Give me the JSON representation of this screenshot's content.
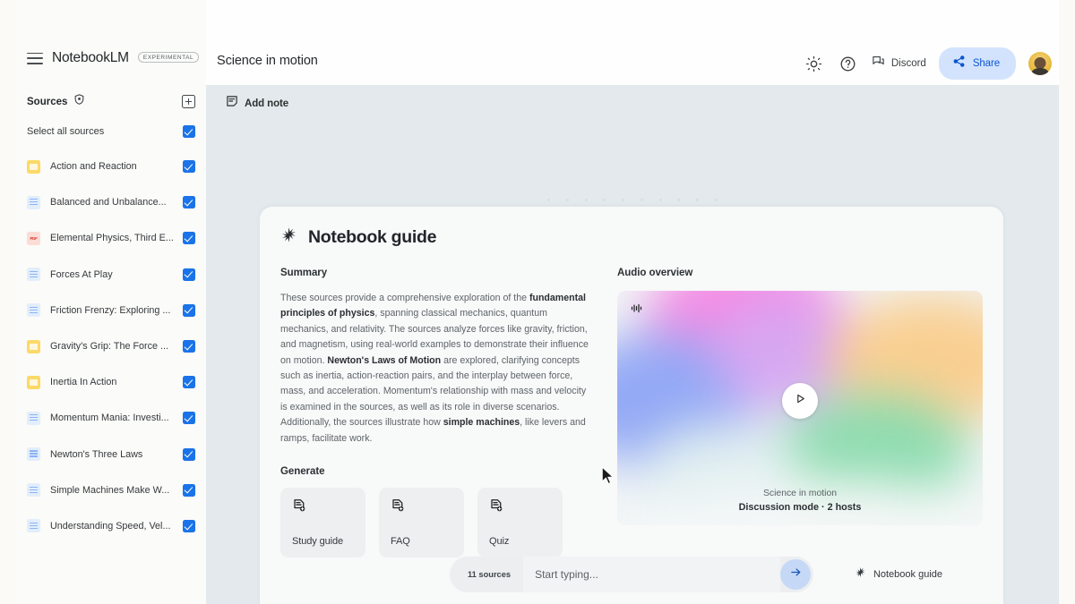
{
  "brand": {
    "name": "NotebookLM",
    "badge": "EXPERIMENTAL",
    "menu_icon": "hamburger-menu-icon"
  },
  "sidebar": {
    "sources_label": "Sources",
    "shield_icon": "shield-icon",
    "add_source_icon": "plus-icon",
    "select_all_label": "Select all sources",
    "sources": [
      {
        "name": "Action and Reaction",
        "icon": "sheet-icon",
        "checked": true
      },
      {
        "name": "Balanced and Unbalance...",
        "icon": "doc-icon",
        "checked": true
      },
      {
        "name": "Elemental Physics, Third E...",
        "icon": "pdf-icon",
        "checked": true
      },
      {
        "name": "Forces At Play",
        "icon": "doc-icon",
        "checked": true
      },
      {
        "name": "Friction Frenzy: Exploring ...",
        "icon": "doc-icon",
        "checked": true
      },
      {
        "name": "Gravity's Grip: The Force ...",
        "icon": "sheet-icon",
        "checked": true
      },
      {
        "name": "Inertia In Action",
        "icon": "sheet-icon",
        "checked": true
      },
      {
        "name": "Momentum Mania: Investi...",
        "icon": "doc-icon",
        "checked": true
      },
      {
        "name": "Newton's Three Laws",
        "icon": "doc-icon",
        "checked": true
      },
      {
        "name": "Simple Machines Make W...",
        "icon": "doc-icon",
        "checked": true
      },
      {
        "name": "Understanding Speed, Vel...",
        "icon": "doc-icon",
        "checked": true
      }
    ]
  },
  "header": {
    "notebook_title": "Science in motion",
    "theme_icon": "brightness-icon",
    "help_icon": "help-circle-icon",
    "discord_icon": "discord-chat-icon",
    "discord_label": "Discord",
    "share_icon": "share-icon",
    "share_label": "Share",
    "avatar": "user-avatar"
  },
  "toolbar": {
    "add_note_icon": "note-add-icon",
    "add_note_label": "Add note"
  },
  "guide": {
    "star_icon": "sparkle-star-icon",
    "title": "Notebook guide",
    "summary_label": "Summary",
    "summary": {
      "p1": "These sources provide a comprehensive exploration of the ",
      "b1": "fundamental principles of physics",
      "p2": ", spanning classical mechanics, quantum mechanics, and relativity. The sources analyze forces like gravity, friction, and magnetism, using real-world examples to demonstrate their influence on motion. ",
      "b2": "Newton's Laws of Motion",
      "p3": " are explored, clarifying concepts such as inertia, action-reaction pairs, and the interplay between force, mass, and acceleration. Momentum's relationship with mass and velocity is examined in the sources, as well as its role in diverse scenarios. Additionally, the sources illustrate how ",
      "b3": "simple machines",
      "p4": ", like levers and ramps, facilitate work."
    },
    "generate_label": "Generate",
    "generate_cards": [
      {
        "label": "Study guide",
        "icon": "doc-add-icon"
      },
      {
        "label": "FAQ",
        "icon": "doc-add-icon"
      },
      {
        "label": "Quiz",
        "icon": "doc-add-icon"
      }
    ]
  },
  "audio": {
    "section_label": "Audio overview",
    "waveform_icon": "waveform-icon",
    "play_icon": "play-icon",
    "title": "Science in motion",
    "subtitle": "Discussion mode · 2 hosts",
    "gradient_colors": [
      "#f08ae0",
      "#8fa7f2",
      "#f7c98a",
      "#8ddcae",
      "#c9a8ef"
    ]
  },
  "composer": {
    "sources_chip": "11 sources",
    "placeholder": "Start typing...",
    "value": "",
    "send_icon": "arrow-right-icon",
    "guide_chip_icon": "sparkle-star-icon",
    "guide_chip_label": "Notebook guide"
  },
  "colors": {
    "accent_blue": "#1a73e8",
    "share_bg": "#d3e3fd",
    "share_text": "#0b57d0",
    "canvas_bg": "#e3e9ec",
    "card_bg": "#f8f9f9"
  }
}
